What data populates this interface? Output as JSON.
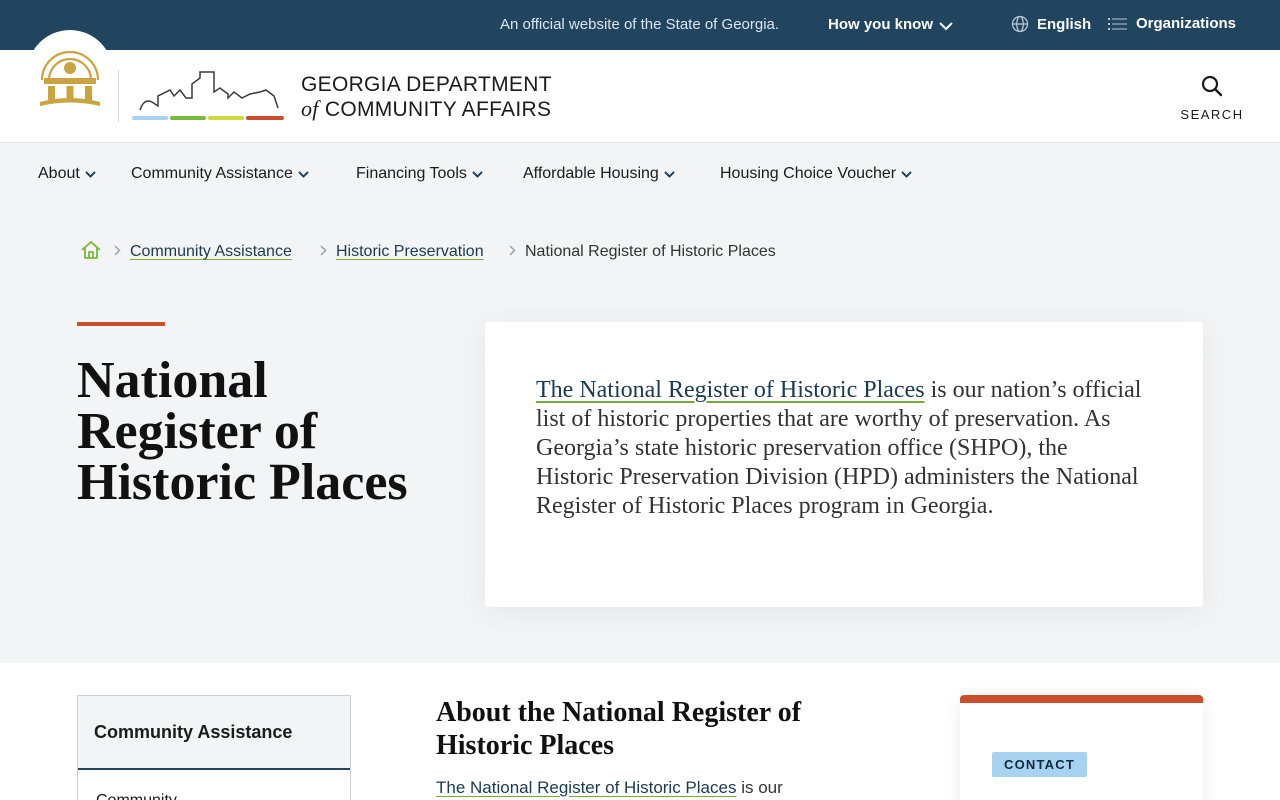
{
  "topbar": {
    "official_text": "An official website of the State of Georgia.",
    "how_you_know": "How you know",
    "language": "English",
    "organizations": "Organizations"
  },
  "header": {
    "agency_line1": "GEORGIA DEPARTMENT",
    "agency_of": "of",
    "agency_line2": "COMMUNITY AFFAIRS",
    "search_label": "SEARCH",
    "skyline_colors": [
      "#a8d3f0",
      "#78b83a",
      "#cfd83f",
      "#c8502c"
    ]
  },
  "nav": {
    "items": [
      {
        "label": "About"
      },
      {
        "label": "Community Assistance"
      },
      {
        "label": "Financing Tools"
      },
      {
        "label": "Affordable Housing"
      },
      {
        "label": "Housing Choice Voucher"
      }
    ]
  },
  "breadcrumb": {
    "items": [
      {
        "label": "Community Assistance"
      },
      {
        "label": "Historic Preservation"
      }
    ],
    "current": "National Register of Historic Places"
  },
  "hero": {
    "title": "National Register of Historic Places",
    "intro_link": "The National Register of Historic Places",
    "intro_rest": " is our nation’s official list of historic properties that are worthy of preservation. As Georgia’s state historic preservation office (SHPO), the Historic Preservation Division (HPD) administers the National Register of Historic Places program in Georgia."
  },
  "sidebar": {
    "heading": "Community Assistance",
    "first_item": "Community"
  },
  "content": {
    "heading": "About the National Register of Historic Places",
    "para_link": "The National Register of Historic Places",
    "para_rest": " is our"
  },
  "contact": {
    "badge": "CONTACT"
  },
  "colors": {
    "topbar_bg": "#21445f",
    "accent_orange": "#c8502c",
    "link_underline": "#78a73a",
    "hero_bg": "#f3f4f5"
  }
}
